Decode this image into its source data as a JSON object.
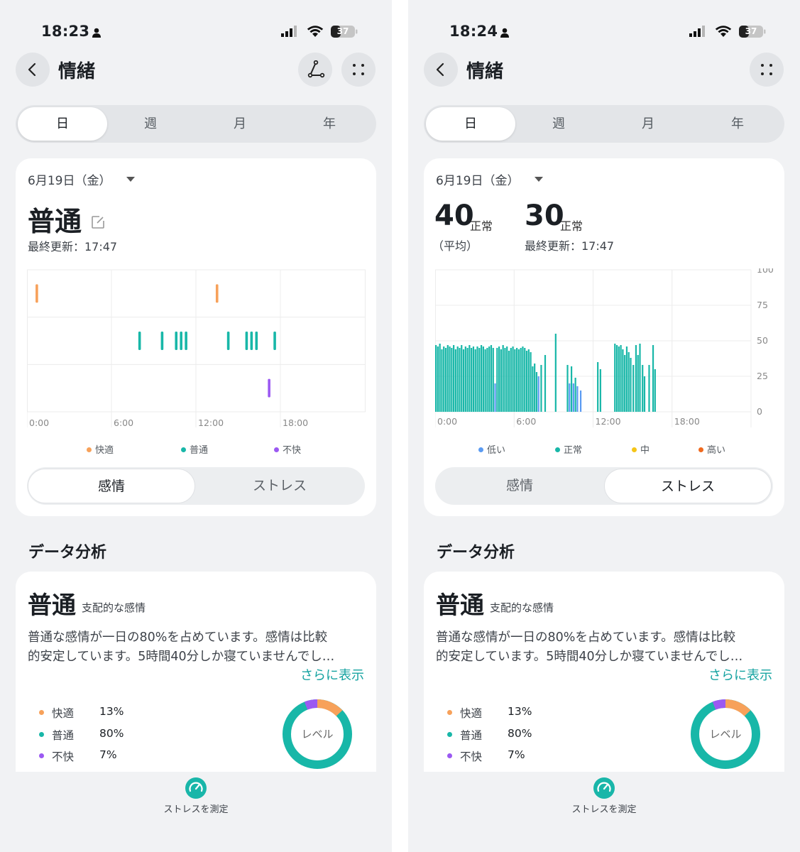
{
  "left": {
    "status": {
      "time": "18:23",
      "battery": "37"
    },
    "nav": {
      "title": "情緒"
    },
    "tabs": [
      "日",
      "週",
      "月",
      "年"
    ],
    "card": {
      "date": "6月19日（金）",
      "mood_value": "普通",
      "updated": "最終更新：17:47"
    },
    "legend": [
      {
        "label": "快適",
        "color": "#f7a15a"
      },
      {
        "label": "普通",
        "color": "#18b7a8"
      },
      {
        "label": "不快",
        "color": "#9b59f2"
      }
    ],
    "segment": [
      "感情",
      "ストレス"
    ],
    "segment_active": 0
  },
  "right": {
    "status": {
      "time": "18:24",
      "battery": "37"
    },
    "nav": {
      "title": "情緒"
    },
    "tabs": [
      "日",
      "週",
      "月",
      "年"
    ],
    "card": {
      "date": "6月19日（金）",
      "avg_value": "40",
      "avg_unit": "正常",
      "avg_label": "（平均）",
      "latest_value": "30",
      "latest_unit": "正常",
      "updated": "最終更新：17:47"
    },
    "legend": [
      {
        "label": "低い",
        "color": "#5b9bf2"
      },
      {
        "label": "正常",
        "color": "#18b7a8"
      },
      {
        "label": "中",
        "color": "#f5c518"
      },
      {
        "label": "高い",
        "color": "#f06a1f"
      }
    ],
    "segment": [
      "感情",
      "ストレス"
    ],
    "segment_active": 1
  },
  "analysis": {
    "section_title": "データ分析",
    "dominant": "普通",
    "dominant_label": "支配的な感情",
    "line1": "普通な感情が一日の80%を占めています。感情は比較",
    "line2": "的安定しています。5時間40分しか寝ていませんでし…",
    "more": "さらに表示",
    "items": [
      {
        "label": "快適",
        "value": "13%",
        "pct": 13,
        "color": "#f7a15a"
      },
      {
        "label": "普通",
        "value": "80%",
        "pct": 80,
        "color": "#18b7a8"
      },
      {
        "label": "不快",
        "value": "7%",
        "pct": 7,
        "color": "#9b59f2"
      }
    ],
    "donut_label": "レベル"
  },
  "fab_label": "ストレスを測定",
  "chart_data": [
    {
      "type": "scatter",
      "title": "",
      "x_ticks": [
        "0:00",
        "6:00",
        "12:00",
        "18:00"
      ],
      "xlim": [
        0,
        24
      ],
      "categories": [
        "快適",
        "普通",
        "不快"
      ],
      "series": [
        {
          "name": "快適",
          "x": [
            0.7,
            13.5
          ]
        },
        {
          "name": "普通",
          "x": [
            8.0,
            9.6,
            10.6,
            10.95,
            11.3,
            14.3,
            15.6,
            15.95,
            16.3,
            17.6
          ]
        },
        {
          "name": "不快",
          "x": [
            17.2
          ]
        }
      ]
    },
    {
      "type": "bar",
      "title": "",
      "x_ticks": [
        "0:00",
        "6:00",
        "12:00",
        "18:00"
      ],
      "y_ticks": [
        "100",
        "75",
        "50",
        "25",
        "0"
      ],
      "xlim": [
        0,
        24
      ],
      "ylim": [
        0,
        100
      ],
      "bars": [
        [
          0.0,
          47,
          "n"
        ],
        [
          0.15,
          46,
          "n"
        ],
        [
          0.3,
          48,
          "n"
        ],
        [
          0.45,
          44,
          "n"
        ],
        [
          0.6,
          46,
          "n"
        ],
        [
          0.75,
          45,
          "n"
        ],
        [
          0.9,
          47,
          "n"
        ],
        [
          1.05,
          46,
          "n"
        ],
        [
          1.2,
          45,
          "n"
        ],
        [
          1.35,
          47,
          "n"
        ],
        [
          1.5,
          44,
          "n"
        ],
        [
          1.65,
          46,
          "n"
        ],
        [
          1.8,
          45,
          "n"
        ],
        [
          1.95,
          47,
          "n"
        ],
        [
          2.1,
          44,
          "n"
        ],
        [
          2.25,
          46,
          "n"
        ],
        [
          2.4,
          45,
          "n"
        ],
        [
          2.55,
          47,
          "n"
        ],
        [
          2.7,
          45,
          "n"
        ],
        [
          2.85,
          46,
          "n"
        ],
        [
          3.0,
          44,
          "n"
        ],
        [
          3.15,
          46,
          "n"
        ],
        [
          3.3,
          45,
          "n"
        ],
        [
          3.45,
          47,
          "n"
        ],
        [
          3.6,
          46,
          "n"
        ],
        [
          3.75,
          44,
          "n"
        ],
        [
          3.9,
          45,
          "n"
        ],
        [
          4.05,
          46,
          "n"
        ],
        [
          4.2,
          47,
          "n"
        ],
        [
          4.35,
          45,
          "n"
        ],
        [
          4.5,
          20,
          "l"
        ],
        [
          4.65,
          45,
          "n"
        ],
        [
          4.8,
          46,
          "n"
        ],
        [
          4.95,
          44,
          "n"
        ],
        [
          5.1,
          47,
          "n"
        ],
        [
          5.25,
          45,
          "n"
        ],
        [
          5.4,
          46,
          "n"
        ],
        [
          5.55,
          43,
          "n"
        ],
        [
          5.7,
          45,
          "n"
        ],
        [
          5.85,
          46,
          "n"
        ],
        [
          6.0,
          44,
          "n"
        ],
        [
          6.15,
          45,
          "n"
        ],
        [
          6.3,
          44,
          "n"
        ],
        [
          6.45,
          45,
          "n"
        ],
        [
          6.6,
          46,
          "n"
        ],
        [
          6.75,
          45,
          "n"
        ],
        [
          6.9,
          43,
          "n"
        ],
        [
          7.05,
          44,
          "n"
        ],
        [
          7.2,
          42,
          "n"
        ],
        [
          7.35,
          32,
          "n"
        ],
        [
          7.5,
          34,
          "n"
        ],
        [
          7.65,
          28,
          "n"
        ],
        [
          7.8,
          25,
          "l"
        ],
        [
          8.0,
          33,
          "n"
        ],
        [
          8.3,
          40,
          "n"
        ],
        [
          9.1,
          55,
          "n"
        ],
        [
          10.0,
          33,
          "n"
        ],
        [
          10.15,
          20,
          "l"
        ],
        [
          10.3,
          32,
          "n"
        ],
        [
          10.45,
          20,
          "l"
        ],
        [
          10.6,
          24,
          "n"
        ],
        [
          10.75,
          18,
          "l"
        ],
        [
          11.0,
          15,
          "l"
        ],
        [
          12.3,
          35,
          "n"
        ],
        [
          12.5,
          30,
          "n"
        ],
        [
          13.6,
          48,
          "n"
        ],
        [
          13.75,
          47,
          "n"
        ],
        [
          13.9,
          46,
          "n"
        ],
        [
          14.05,
          47,
          "n"
        ],
        [
          14.2,
          44,
          "n"
        ],
        [
          14.35,
          40,
          "n"
        ],
        [
          14.5,
          46,
          "n"
        ],
        [
          14.65,
          42,
          "n"
        ],
        [
          14.8,
          38,
          "n"
        ],
        [
          15.0,
          33,
          "n"
        ],
        [
          15.2,
          47,
          "n"
        ],
        [
          15.35,
          40,
          "n"
        ],
        [
          15.5,
          48,
          "n"
        ],
        [
          15.7,
          33,
          "n"
        ],
        [
          15.85,
          25,
          "n"
        ],
        [
          16.2,
          33,
          "n"
        ],
        [
          16.5,
          47,
          "n"
        ],
        [
          16.65,
          30,
          "n"
        ]
      ]
    }
  ]
}
